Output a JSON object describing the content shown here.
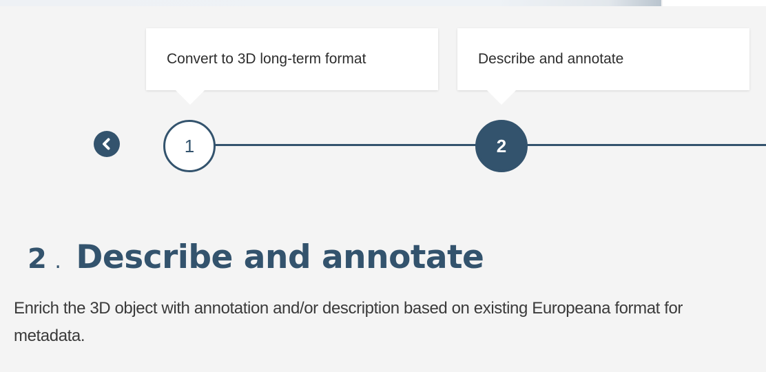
{
  "timeline": {
    "steps": [
      {
        "number": "1",
        "tooltip": "Convert to 3D long-term format",
        "active": false
      },
      {
        "number": "2",
        "tooltip": "Describe and annotate",
        "active": true
      }
    ],
    "prev_icon": "chevron-left-icon"
  },
  "section": {
    "number": "2",
    "separator": ".",
    "title": "Describe and annotate",
    "description": "Enrich the 3D object with annotation and/or description based on existing Europeana format for metadata."
  },
  "colors": {
    "accent": "#33536d",
    "background": "#f4f4f4",
    "tooltip_bg": "#ffffff",
    "text": "#3a3a3a"
  }
}
